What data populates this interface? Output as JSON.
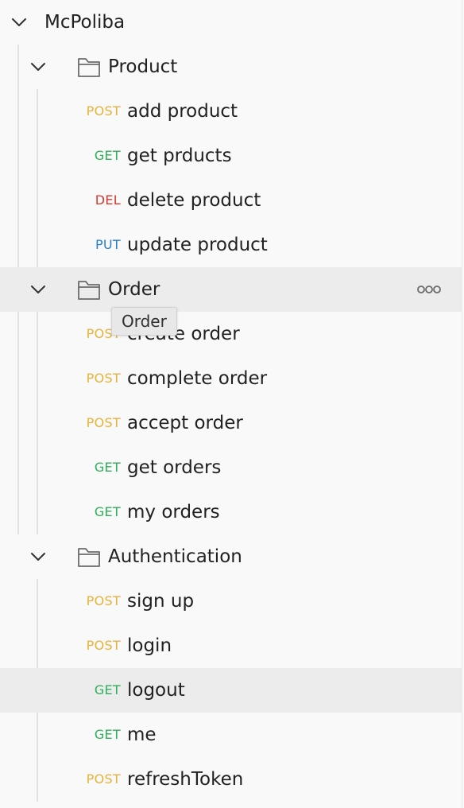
{
  "colors": {
    "POST": "#e8b23a",
    "GET": "#2eae5a",
    "DEL": "#d9362c",
    "PUT": "#2b7fcf"
  },
  "collection": {
    "name": "McPoliba",
    "folders": [
      {
        "name": "Product",
        "requests": [
          {
            "method": "POST",
            "name": "add product"
          },
          {
            "method": "GET",
            "name": "get prducts"
          },
          {
            "method": "DEL",
            "name": "delete product"
          },
          {
            "method": "PUT",
            "name": "update product"
          }
        ]
      },
      {
        "name": "Order",
        "requests": [
          {
            "method": "POST",
            "name": "create order"
          },
          {
            "method": "POST",
            "name": "complete order"
          },
          {
            "method": "POST",
            "name": "accept order"
          },
          {
            "method": "GET",
            "name": "get orders"
          },
          {
            "method": "GET",
            "name": "my orders"
          }
        ]
      },
      {
        "name": "Authentication",
        "requests": [
          {
            "method": "POST",
            "name": "sign up"
          },
          {
            "method": "POST",
            "name": "login"
          },
          {
            "method": "GET",
            "name": "logout"
          },
          {
            "method": "GET",
            "name": "me"
          },
          {
            "method": "POST",
            "name": "refreshToken"
          }
        ]
      }
    ]
  },
  "tooltip": {
    "text": "Order"
  },
  "icons": {
    "chevron": "chevron-down-icon",
    "folder": "folder-icon",
    "more": "more-options-icon"
  }
}
